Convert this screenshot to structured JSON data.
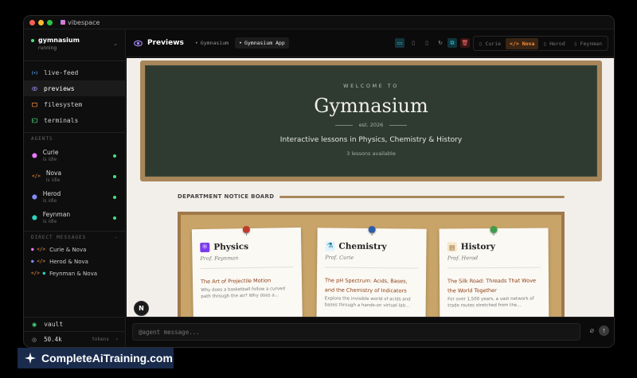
{
  "window": {
    "title": "vibespace",
    "traffic": [
      "#ff5f57",
      "#febc2e",
      "#28c840"
    ]
  },
  "workspace": {
    "name": "gymnasium",
    "status": "running"
  },
  "nav": [
    {
      "label": "live-feed",
      "icon": "signal-icon",
      "color": "#60a5fa"
    },
    {
      "label": "previews",
      "icon": "eye-icon",
      "color": "#a78bfa"
    },
    {
      "label": "filesystem",
      "icon": "folder-icon",
      "color": "#fb923c"
    },
    {
      "label": "terminals",
      "icon": "terminal-icon",
      "color": "#4ade80"
    }
  ],
  "agents_header": "AGENTS",
  "agents": [
    {
      "name": "Curie",
      "status": "is idle",
      "color": "#e879f9"
    },
    {
      "name": "Nova",
      "status": "is idle",
      "color": "#fb923c"
    },
    {
      "name": "Herod",
      "status": "is idle",
      "color": "#818cf8"
    },
    {
      "name": "Feynman",
      "status": "is idle",
      "color": "#2dd4bf"
    }
  ],
  "dm_header": "DIRECT MESSAGES",
  "dms": [
    {
      "label": "Curie & Nova"
    },
    {
      "label": "Herod & Nova"
    },
    {
      "label": "Feynman & Nova"
    }
  ],
  "vault": "vault",
  "tokens": {
    "value": "50.4k",
    "label": "tokens"
  },
  "topbar": {
    "title": "Previews",
    "tabs": [
      "Gymnasium",
      "Gymnasium App"
    ],
    "switcher": [
      "Curie",
      "Nova",
      "Herod",
      "Feynman"
    ]
  },
  "preview": {
    "welcome": "WELCOME TO",
    "title": "Gymnasium",
    "est": "est. 2026",
    "subtitle": "Interactive lessons in Physics, Chemistry & History",
    "lessons_count": "3 lessons available",
    "notice_title": "DEPARTMENT NOTICE BOARD",
    "cards": [
      {
        "subject": "Physics",
        "prof": "Prof. Feynman",
        "lesson": "The Art of Projectile Motion",
        "desc": "Why does a basketball follow a curved path through the air? Why does a...",
        "pin": "#c0392b",
        "icon": "atom-icon",
        "iconGlyph": "⚛",
        "iconBg": "#7c3aed"
      },
      {
        "subject": "Chemistry",
        "prof": "Prof. Curie",
        "lesson": "The pH Spectrum: Acids, Bases, and the Chemistry of Indicators",
        "desc": "Explore the invisible world of acids and bases through a hands-on virtual lab...",
        "pin": "#2c5ea8",
        "icon": "flask-icon",
        "iconGlyph": "⚗",
        "iconBg": "#e0f2fe"
      },
      {
        "subject": "History",
        "prof": "Prof. Herod",
        "lesson": "The Silk Road: Threads That Wove the World Together",
        "desc": "For over 1,500 years, a vast network of trade routes stretched from the...",
        "pin": "#3f9c4a",
        "icon": "scroll-icon",
        "iconGlyph": "📜",
        "iconBg": "#f5e6c8"
      }
    ]
  },
  "badge": "N",
  "composer": {
    "placeholder": "@agent message..."
  },
  "watermark": "CompleteAiTraining.com"
}
